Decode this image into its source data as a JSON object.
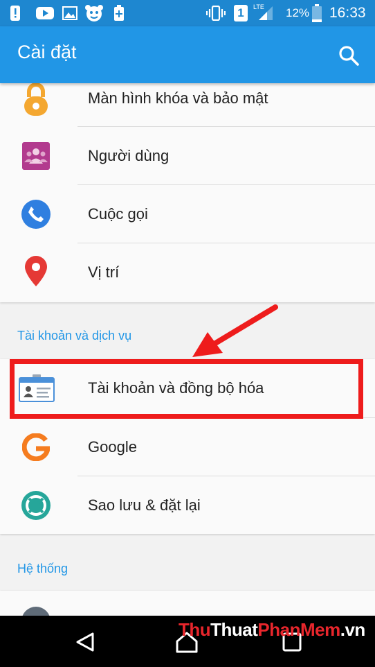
{
  "status_bar": {
    "lte": "LTE",
    "sim": "1",
    "battery": "12%",
    "time": "16:33"
  },
  "app_bar": {
    "title": "Cài đặt"
  },
  "items": {
    "lock": "Màn hình khóa và bảo mật",
    "users": "Người dùng",
    "calls": "Cuộc gọi",
    "location": "Vị trí",
    "accounts_sync": "Tài khoản và đồng bộ hóa",
    "google": "Google",
    "backup": "Sao lưu & đặt lại"
  },
  "sections": {
    "accounts": "Tài khoản và dịch vụ",
    "system": "Hệ thống"
  },
  "watermark": {
    "part1": "Thu",
    "part2": "Thuat",
    "part3": "PhanMem",
    "part4": ".vn"
  },
  "colors": {
    "status_bar": "#1e87d0",
    "app_bar": "#2196e6",
    "accent": "#2196e6",
    "highlight": "#ee1c1c"
  }
}
